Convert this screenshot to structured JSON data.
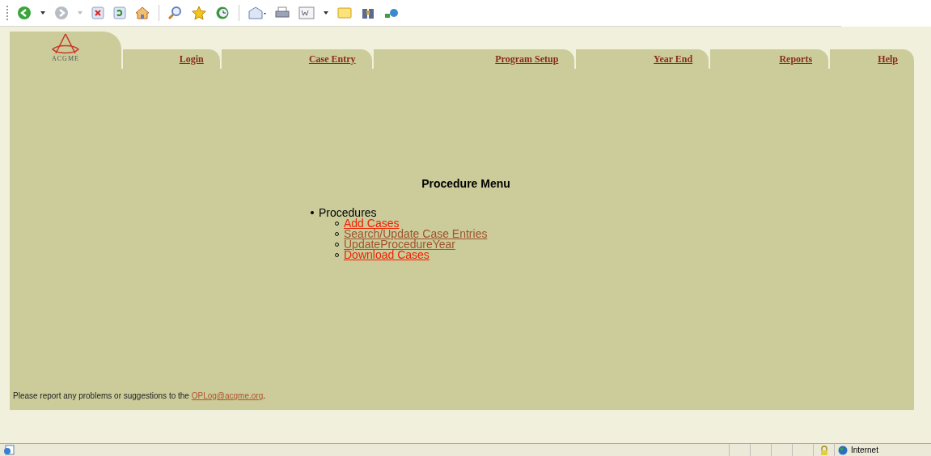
{
  "logo": {
    "text": "ACGME"
  },
  "tabs": [
    {
      "label": "Login"
    },
    {
      "label": "Case Entry"
    },
    {
      "label": "Program Setup"
    },
    {
      "label": "Year End"
    },
    {
      "label": "Reports"
    },
    {
      "label": "Help"
    }
  ],
  "main": {
    "title": "Procedure Menu",
    "section": "Procedures",
    "links": [
      {
        "label": "Add Cases",
        "visited": false
      },
      {
        "label": "Search/Update Case Entries",
        "visited": true
      },
      {
        "label": "UpdateProcedureYear",
        "visited": true
      },
      {
        "label": "Download Cases",
        "visited": false
      }
    ]
  },
  "footer": {
    "text": "Please report any problems or suggestions to the ",
    "link": "OPLog@acgme.org",
    "link_visited": true,
    "end": "."
  },
  "status_bar": {
    "zone": "Internet"
  }
}
